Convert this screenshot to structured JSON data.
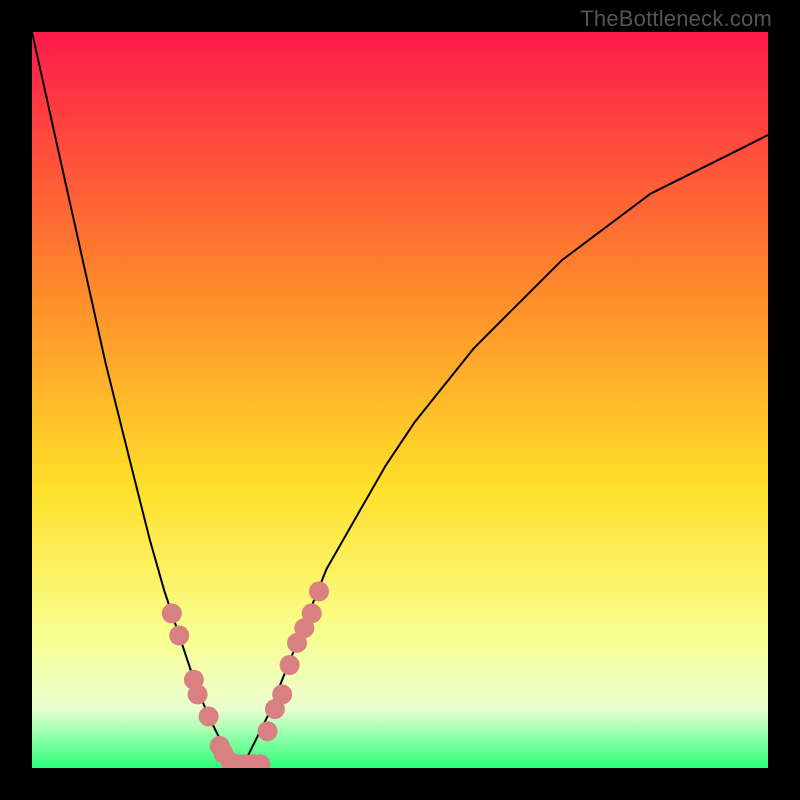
{
  "watermark": "TheBottleneck.com",
  "chart_data": {
    "type": "line",
    "title": "",
    "xlabel": "",
    "ylabel": "",
    "xlim": [
      0,
      100
    ],
    "ylim": [
      0,
      100
    ],
    "background_gradient": {
      "top_color": "#ff1a4b",
      "mid_upper_color": "#ff8a2a",
      "mid_color": "#ffe02a",
      "mid_lower_color": "#f8ff90",
      "bottom_color": "#2aff7a"
    },
    "curve": {
      "description": "Bottleneck-style V curve: steep left wall, minimum near x≈28, convex rise to the right.",
      "minimum_x": 28,
      "minimum_y": 0,
      "x": [
        0,
        2,
        4,
        6,
        8,
        10,
        12,
        14,
        16,
        18,
        20,
        22,
        24,
        26,
        27,
        28,
        29,
        30,
        32,
        34,
        36,
        38,
        40,
        44,
        48,
        52,
        56,
        60,
        64,
        68,
        72,
        76,
        80,
        84,
        88,
        92,
        96,
        100
      ],
      "y": [
        100,
        91,
        82,
        73,
        64,
        55,
        47,
        39,
        31,
        24,
        18,
        12,
        7,
        3,
        1,
        0,
        1,
        3,
        7,
        12,
        17,
        22,
        27,
        34,
        41,
        47,
        52,
        57,
        61,
        65,
        69,
        72,
        75,
        78,
        80,
        82,
        84,
        86
      ]
    },
    "dots": {
      "color": "#d98083",
      "radius_px": 10,
      "points": [
        {
          "x": 19,
          "y": 21
        },
        {
          "x": 20,
          "y": 18
        },
        {
          "x": 22,
          "y": 12
        },
        {
          "x": 22.5,
          "y": 10
        },
        {
          "x": 24,
          "y": 7
        },
        {
          "x": 25.5,
          "y": 3
        },
        {
          "x": 26,
          "y": 2
        },
        {
          "x": 27,
          "y": 0.8
        },
        {
          "x": 28,
          "y": 0.5
        },
        {
          "x": 29,
          "y": 0.5
        },
        {
          "x": 30,
          "y": 0.5
        },
        {
          "x": 31,
          "y": 0.5
        },
        {
          "x": 32,
          "y": 5
        },
        {
          "x": 33,
          "y": 8
        },
        {
          "x": 34,
          "y": 10
        },
        {
          "x": 35,
          "y": 14
        },
        {
          "x": 36,
          "y": 17
        },
        {
          "x": 37,
          "y": 19
        },
        {
          "x": 38,
          "y": 21
        },
        {
          "x": 39,
          "y": 24
        }
      ]
    }
  }
}
